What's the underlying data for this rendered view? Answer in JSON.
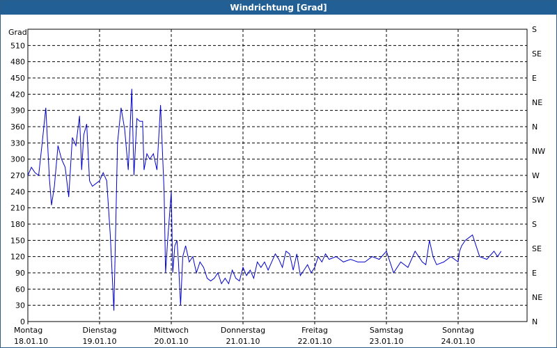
{
  "window": {
    "title": "Windrichtung [Grad]"
  },
  "chart_data": {
    "type": "line",
    "title": "Windrichtung [Grad]",
    "ylabel": "Grad",
    "ylim": [
      0,
      540
    ],
    "grid": true,
    "left_ticks": [
      "0",
      "30",
      "60",
      "90",
      "120",
      "150",
      "180",
      "210",
      "240",
      "270",
      "300",
      "330",
      "360",
      "390",
      "420",
      "450",
      "480",
      "510"
    ],
    "right_ticks": [
      "N",
      "NE",
      "E",
      "SE",
      "S",
      "SW",
      "W",
      "NW",
      "N",
      "NE",
      "E",
      "SE",
      "S"
    ],
    "x_ticks": [
      {
        "day": "Montag",
        "date": "18.01.10"
      },
      {
        "day": "Dienstag",
        "date": "19.01.10"
      },
      {
        "day": "Mittwoch",
        "date": "20.01.10"
      },
      {
        "day": "Donnerstag",
        "date": "21.01.10"
      },
      {
        "day": "Freitag",
        "date": "22.01.10"
      },
      {
        "day": "Samstag",
        "date": "23.01.10"
      },
      {
        "day": "Sonntag",
        "date": "24.01.10"
      }
    ],
    "series": [
      {
        "color": "#0000cc",
        "x_days": [
          0,
          0.05,
          0.1,
          0.15,
          0.2,
          0.25,
          0.3,
          0.33,
          0.37,
          0.42,
          0.47,
          0.52,
          0.57,
          0.62,
          0.67,
          0.72,
          0.75,
          0.78,
          0.82,
          0.86,
          0.9,
          0.95,
          1.0,
          1.05,
          1.1,
          1.15,
          1.2,
          1.25,
          1.3,
          1.35,
          1.4,
          1.45,
          1.48,
          1.52,
          1.56,
          1.6,
          1.62,
          1.66,
          1.7,
          1.75,
          1.8,
          1.85,
          1.9,
          1.92,
          1.95,
          2.0,
          2.02,
          2.05,
          2.08,
          2.1,
          2.13,
          2.16,
          2.2,
          2.25,
          2.3,
          2.35,
          2.4,
          2.45,
          2.5,
          2.55,
          2.6,
          2.65,
          2.7,
          2.75,
          2.8,
          2.85,
          2.9,
          2.95,
          3.0,
          3.05,
          3.1,
          3.15,
          3.2,
          3.25,
          3.3,
          3.35,
          3.4,
          3.45,
          3.5,
          3.55,
          3.6,
          3.65,
          3.7,
          3.75,
          3.8,
          3.85,
          3.9,
          3.95,
          4.0,
          4.05,
          4.1,
          4.15,
          4.2,
          4.3,
          4.4,
          4.5,
          4.6,
          4.7,
          4.8,
          4.9,
          5.0,
          5.1,
          5.2,
          5.3,
          5.4,
          5.5,
          5.55,
          5.6,
          5.65,
          5.7,
          5.8,
          5.9,
          6.0,
          6.02,
          6.05,
          6.1,
          6.2,
          6.3,
          6.4,
          6.5,
          6.55,
          6.6,
          6.65,
          6.7,
          6.8,
          6.9,
          6.97
        ],
        "values": [
          270,
          285,
          275,
          270,
          330,
          395,
          265,
          215,
          250,
          325,
          300,
          285,
          230,
          340,
          325,
          380,
          280,
          345,
          365,
          260,
          250,
          255,
          260,
          275,
          260,
          160,
          20,
          330,
          395,
          355,
          280,
          430,
          270,
          375,
          370,
          370,
          280,
          310,
          300,
          310,
          280,
          400,
          240,
          90,
          150,
          240,
          90,
          140,
          150,
          110,
          30,
          120,
          140,
          110,
          120,
          90,
          110,
          100,
          80,
          75,
          80,
          90,
          70,
          80,
          70,
          95,
          80,
          75,
          100,
          85,
          95,
          80,
          110,
          100,
          110,
          95,
          110,
          125,
          115,
          100,
          130,
          125,
          95,
          125,
          85,
          95,
          105,
          90,
          100,
          120,
          110,
          125,
          115,
          120,
          110,
          115,
          110,
          110,
          120,
          115,
          130,
          90,
          110,
          100,
          130,
          110,
          105,
          150,
          120,
          105,
          110,
          120,
          110,
          130,
          140,
          150,
          160,
          120,
          115,
          130,
          120,
          130
        ]
      }
    ]
  }
}
